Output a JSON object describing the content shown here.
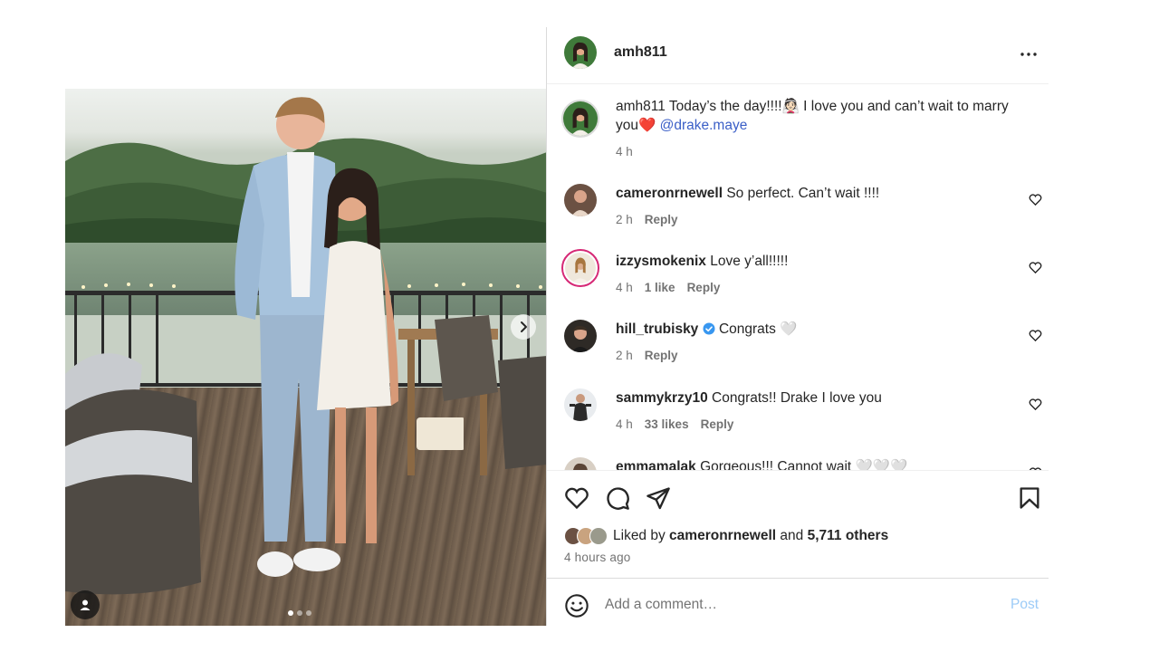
{
  "post": {
    "username": "amh811",
    "caption_user": "amh811",
    "caption_text": "Today’s the day!!!!👰🏻 I love you and can’t wait to marry you❤️",
    "caption_mention": "@drake.maye",
    "caption_time": "4 h"
  },
  "comments": [
    {
      "user": "cameronrnewell",
      "text": "So perfect. Can’t wait !!!!",
      "time": "2 h",
      "likes": "",
      "reply": "Reply",
      "verified": false
    },
    {
      "user": "izzysmokenix",
      "text": "Love y’all!!!!!",
      "time": "4 h",
      "likes": "1 like",
      "reply": "Reply",
      "verified": false
    },
    {
      "user": "hill_trubisky",
      "text": "Congrats 🤍",
      "time": "2 h",
      "likes": "",
      "reply": "Reply",
      "verified": true
    },
    {
      "user": "sammykrzy10",
      "text": "Congrats!! Drake I love you",
      "time": "4 h",
      "likes": "33 likes",
      "reply": "Reply",
      "verified": false
    },
    {
      "user": "emmamalak",
      "text": "Gorgeous!!! Cannot wait 🤍🤍🤍",
      "time": "",
      "likes": "",
      "reply": "",
      "verified": false
    }
  ],
  "likes": {
    "prefix": "Liked by",
    "user": "cameronrnewell",
    "and": "and",
    "others": "5,711 others",
    "time_ago": "4 hours ago"
  },
  "add_comment": {
    "placeholder": "Add a comment…",
    "post_label": "Post"
  },
  "icons": {
    "more": "more-options-icon",
    "like": "heart-icon",
    "comment": "comment-icon",
    "share": "share-icon",
    "save": "bookmark-icon",
    "emoji": "emoji-icon",
    "next": "chevron-right-icon",
    "user_tag": "user-tag-icon"
  },
  "colors": {
    "mention": "#3b5fc7",
    "post_button": "#9ccbf7",
    "verified": "#3897f0",
    "story_ring": "#d62976"
  },
  "carousel": {
    "count": 3,
    "active_index": 1
  }
}
